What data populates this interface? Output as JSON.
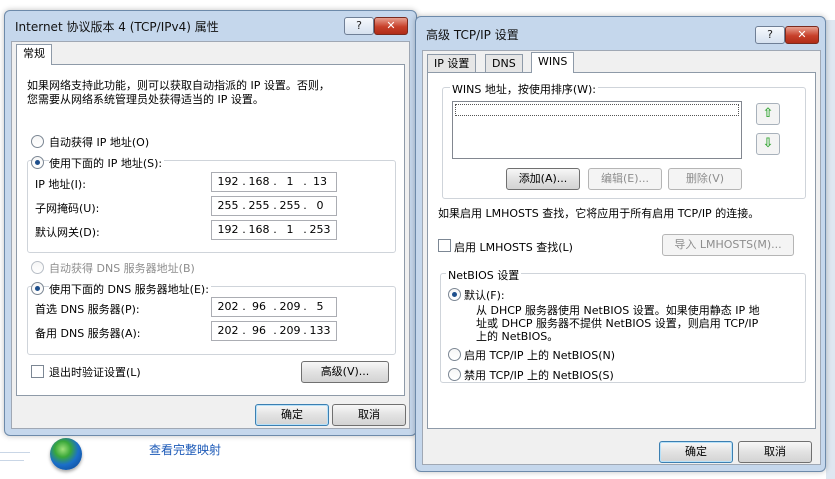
{
  "background": {
    "map_link": "查看完整映射",
    "globe_icon": "globe-icon"
  },
  "ipv4_dialog": {
    "title": "Internet 协议版本 4 (TCP/IPv4) 属性",
    "help_btn": "?",
    "close_btn": "✕",
    "tab": "常规",
    "desc": [
      "如果网络支持此功能，则可以获取自动指派的 IP 设置。否则，",
      "您需要从网络系统管理员处获得适当的 IP 设置。"
    ],
    "auto_ip": "自动获得 IP 地址(O)",
    "manual_ip": "使用下面的 IP 地址(S):",
    "ip_label": "IP 地址(I):",
    "ip": [
      "192",
      "168",
      "1",
      "13"
    ],
    "mask_label": "子网掩码(U):",
    "mask": [
      "255",
      "255",
      "255",
      "0"
    ],
    "gateway_label": "默认网关(D):",
    "gateway": [
      "192",
      "168",
      "1",
      "253"
    ],
    "auto_dns": "自动获得 DNS 服务器地址(B)",
    "manual_dns": "使用下面的 DNS 服务器地址(E):",
    "dns1_label": "首选 DNS 服务器(P):",
    "dns1": [
      "202",
      "96",
      "209",
      "5"
    ],
    "dns2_label": "备用 DNS 服务器(A):",
    "dns2": [
      "202",
      "96",
      "209",
      "133"
    ],
    "validate": "退出时验证设置(L)",
    "advanced": "高级(V)...",
    "ok": "确定",
    "cancel": "取消"
  },
  "adv_dialog": {
    "title": "高级 TCP/IP 设置",
    "help_btn": "?",
    "close_btn": "✕",
    "tabs": [
      "IP 设置",
      "DNS",
      "WINS"
    ],
    "wins_group": "WINS 地址，按使用排序(W):",
    "up_icon": "⇧",
    "down_icon": "⇩",
    "add": "添加(A)...",
    "edit": "编辑(E)...",
    "remove": "删除(V)",
    "lmhosts_note": "如果启用 LMHOSTS 查找，它将应用于所有启用 TCP/IP 的连接。",
    "enable_lmhosts": "启用 LMHOSTS 查找(L)",
    "import_lmhosts": "导入 LMHOSTS(M)...",
    "netbios_group": "NetBIOS 设置",
    "default_opt": "默认(F):",
    "default_desc": [
      "从 DHCP 服务器使用 NetBIOS 设置。如果使用静态 IP 地",
      "址或 DHCP 服务器不提供 NetBIOS 设置，则启用 TCP/IP",
      "上的 NetBIOS。"
    ],
    "enable_netbios": "启用 TCP/IP 上的 NetBIOS(N)",
    "disable_netbios": "禁用 TCP/IP 上的 NetBIOS(S)",
    "ok": "确定",
    "cancel": "取消"
  }
}
